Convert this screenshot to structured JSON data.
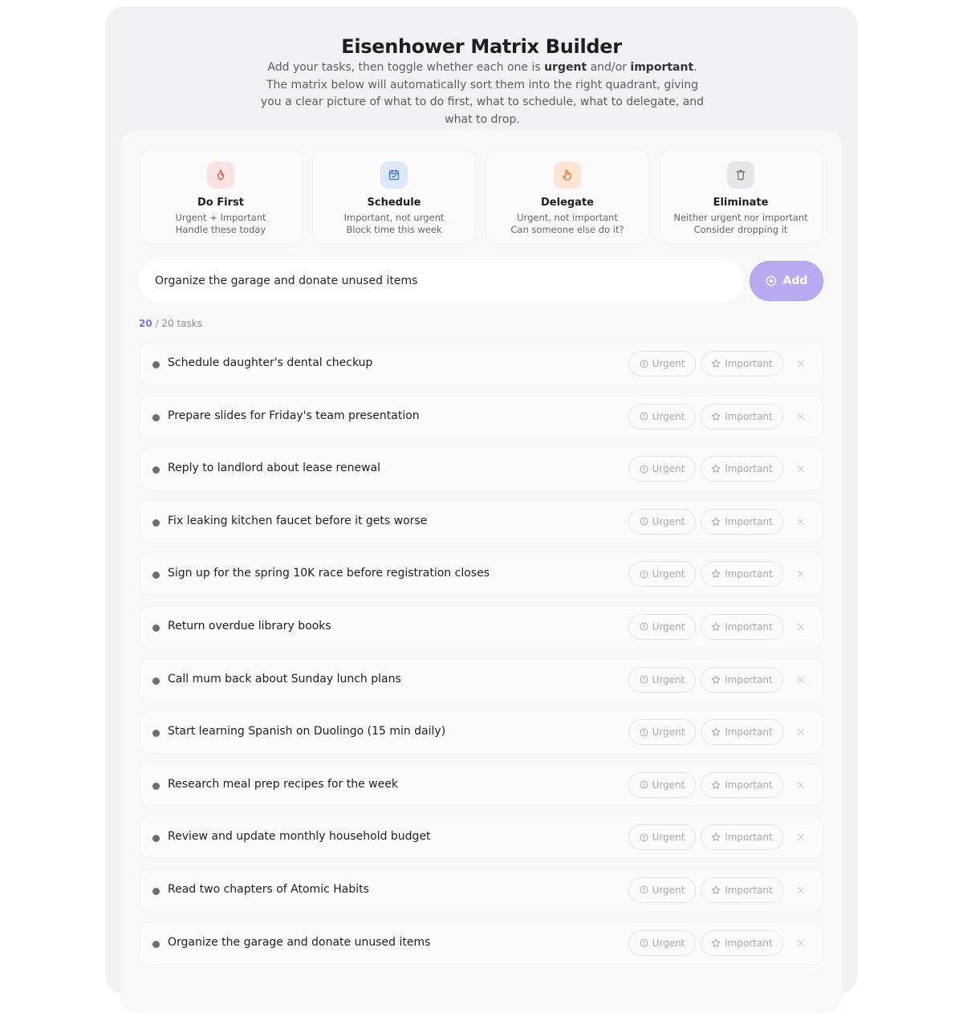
{
  "header": {
    "title": "Eisenhower Matrix Builder",
    "intro_1": "Add your tasks, then toggle whether each one is ",
    "intro_bold_1": "urgent",
    "intro_2": " and/or ",
    "intro_bold_2": "important",
    "intro_3": ". The matrix below will automatically sort them into the right quadrant, giving you a clear picture of what to do first, what to schedule, what to delegate, and what to drop."
  },
  "quadrants": [
    {
      "icon": "flame-icon",
      "title": "Do First",
      "line1": "Urgent + Important",
      "line2": "Handle these today",
      "color": "#e0523a"
    },
    {
      "icon": "calendar-check-icon",
      "title": "Schedule",
      "line1": "Important, not urgent",
      "line2": "Block time this week",
      "color": "#3d6fdb"
    },
    {
      "icon": "hand-icon",
      "title": "Delegate",
      "line1": "Urgent, not important",
      "line2": "Can someone else do it?",
      "color": "#e8772e"
    },
    {
      "icon": "trash-icon",
      "title": "Eliminate",
      "line1": "Neither urgent nor important",
      "line2": "Consider dropping it",
      "color": "#6e6e76"
    }
  ],
  "composer": {
    "input_value": "Organize the garage and donate unused items",
    "add_label": "Add"
  },
  "counter": {
    "count": "20",
    "suffix": " / 20 tasks"
  },
  "toggles": {
    "urgent_label": "Urgent",
    "important_label": "Important"
  },
  "tasks": [
    {
      "text": "Schedule daughter's dental checkup"
    },
    {
      "text": "Prepare slides for Friday's team presentation"
    },
    {
      "text": "Reply to landlord about lease renewal"
    },
    {
      "text": "Fix leaking kitchen faucet before it gets worse"
    },
    {
      "text": "Sign up for the spring 10K race before registration closes"
    },
    {
      "text": "Return overdue library books"
    },
    {
      "text": "Call mum back about Sunday lunch plans"
    },
    {
      "text": "Start learning Spanish on Duolingo (15 min daily)"
    },
    {
      "text": "Research meal prep recipes for the week"
    },
    {
      "text": "Review and update monthly household budget"
    },
    {
      "text": "Read two chapters of Atomic Habits"
    },
    {
      "text": "Organize the garage and donate unused items"
    }
  ]
}
